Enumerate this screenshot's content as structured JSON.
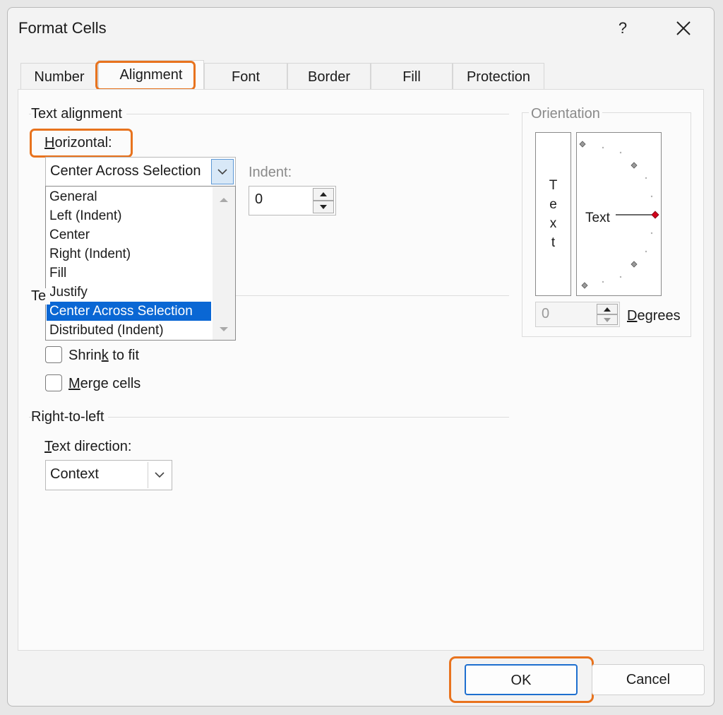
{
  "window": {
    "title": "Format Cells",
    "help_label": "?"
  },
  "tabs": [
    {
      "label": "Number",
      "active": false
    },
    {
      "label": "Alignment",
      "active": true
    },
    {
      "label": "Font",
      "active": false
    },
    {
      "label": "Border",
      "active": false
    },
    {
      "label": "Fill",
      "active": false
    },
    {
      "label": "Protection",
      "active": false
    }
  ],
  "text_alignment": {
    "section_label": "Text alignment",
    "horizontal": {
      "label_key": "H",
      "label_rest": "orizontal:",
      "value": "Center Across Selection",
      "options": [
        "General",
        "Left (Indent)",
        "Center",
        "Right (Indent)",
        "Fill",
        "Justify",
        "Center Across Selection",
        "Distributed (Indent)"
      ],
      "selected_index": 6
    },
    "indent": {
      "label": "Indent:",
      "value": "0"
    },
    "hidden_section_stub": "Te"
  },
  "text_control": {
    "shrink": {
      "pre": "Shrin",
      "key": "k",
      "post": " to fit",
      "checked": false
    },
    "merge": {
      "pre": "",
      "key": "M",
      "post": "erge cells",
      "checked": false
    }
  },
  "right_to_left": {
    "section_label": "Right-to-left",
    "direction": {
      "label_key": "T",
      "label_rest": "ext direction:",
      "value": "Context"
    }
  },
  "orientation": {
    "section_label": "Orientation",
    "vertical_letters": [
      "T",
      "e",
      "x",
      "t"
    ],
    "arc_text": "Text",
    "degrees_value": "0",
    "degrees_key": "D",
    "degrees_rest": "egrees"
  },
  "footer": {
    "ok_label": "OK",
    "cancel_label": "Cancel"
  },
  "colors": {
    "accent_highlight": "#e8731e",
    "selection": "#0a67d4",
    "primary_border": "#1e6fcf",
    "orientation_marker": "#d0021b"
  }
}
